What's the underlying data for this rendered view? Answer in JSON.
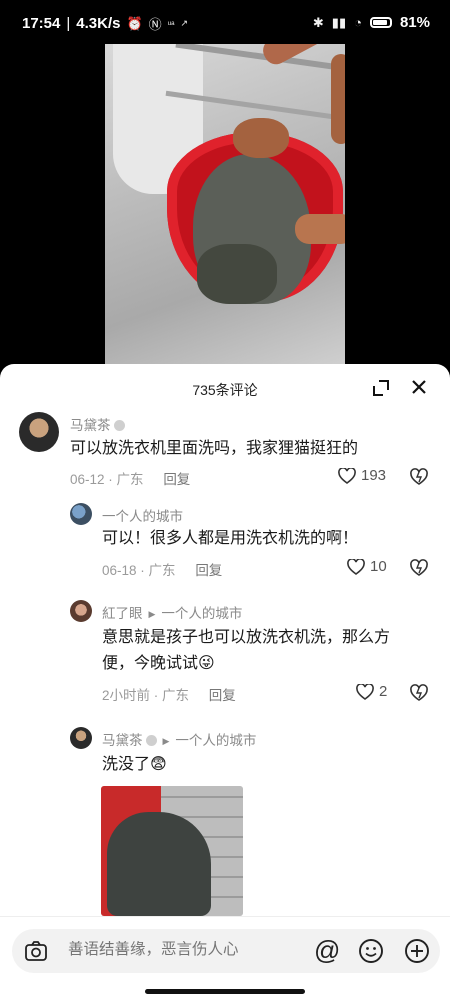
{
  "status_bar": {
    "time": "17:54",
    "speed": "4.3K/s",
    "battery": "81%",
    "icons": [
      "alarm-icon",
      "nfc-icon",
      "bluetooth-icon",
      "signal-icon",
      "wifi-icon",
      "battery-icon"
    ]
  },
  "video": {
    "description_icon": "video-thumbnail"
  },
  "panel": {
    "title": "735条评论"
  },
  "comments": [
    {
      "user": "马黛茶",
      "text": "可以放洗衣机里面洗吗，我家狸猫挺狂的",
      "date": "06-12",
      "location": "广东",
      "reply_label": "回复",
      "likes": "193"
    },
    {
      "user": "一个人的城市",
      "text": "可以！很多人都是用洗衣机洗的啊！",
      "date": "06-18",
      "location": "广东",
      "reply_label": "回复",
      "likes": "10"
    },
    {
      "user": "紅了眼",
      "reply_to": "一个人的城市",
      "text_line1": "意思就是孩子也可以放洗衣机洗，那么方",
      "text_line2": "便，今晚试试",
      "text_emoji": "😜",
      "date": "2小时前",
      "location": "广东",
      "reply_label": "回复",
      "likes": "2"
    },
    {
      "user": "马黛茶",
      "reply_to": "一个人的城市",
      "text": "洗没了",
      "text_emoji": "😨"
    }
  ],
  "input_bar": {
    "placeholder": "善语结善缘，恶言伤人心"
  },
  "colors": {
    "panel_bg": "#ffffff",
    "meta_gray": "#9a9a9a",
    "text_dark": "#1a1a1a"
  }
}
